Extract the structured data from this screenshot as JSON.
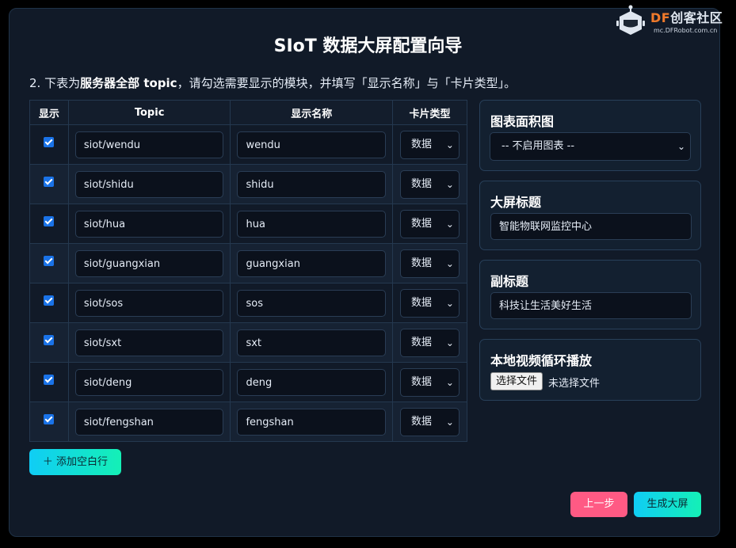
{
  "header": {
    "title": "SIoT 数据大屏配置向导",
    "logo_brand": "DF",
    "logo_name": "创客社区",
    "logo_url": "mc.DFRobot.com.cn"
  },
  "intro": {
    "prefix": "2. 下表为",
    "bold1": "服务器全部 topic",
    "middle": "，请勾选需要显示的模块，并填写「显示名称」与「卡片类型」。"
  },
  "table": {
    "headers": [
      "显示",
      "Topic",
      "显示名称",
      "卡片类型"
    ],
    "rows": [
      {
        "checked": true,
        "topic": "siot/wendu",
        "name": "wendu",
        "type": "数据"
      },
      {
        "checked": true,
        "topic": "siot/shidu",
        "name": "shidu",
        "type": "数据"
      },
      {
        "checked": true,
        "topic": "siot/hua",
        "name": "hua",
        "type": "数据"
      },
      {
        "checked": true,
        "topic": "siot/guangxian",
        "name": "guangxian",
        "type": "数据"
      },
      {
        "checked": true,
        "topic": "siot/sos",
        "name": "sos",
        "type": "数据"
      },
      {
        "checked": true,
        "topic": "siot/sxt",
        "name": "sxt",
        "type": "数据"
      },
      {
        "checked": true,
        "topic": "siot/deng",
        "name": "deng",
        "type": "数据"
      },
      {
        "checked": true,
        "topic": "siot/fengshan",
        "name": "fengshan",
        "type": "数据"
      }
    ]
  },
  "add_row_label": "＋ 添加空白行",
  "side": {
    "chart": {
      "title": "图表面积图",
      "value": "-- 不启用图表 --"
    },
    "screen_title": {
      "title": "大屏标题",
      "value": "智能物联网监控中心"
    },
    "subtitle": {
      "title": "副标题",
      "value": "科技让生活美好生活"
    },
    "video": {
      "title": "本地视频循环播放",
      "button": "选择文件",
      "status": "未选择文件"
    }
  },
  "footer": {
    "prev": "上一步",
    "generate": "生成大屏"
  },
  "colors": {
    "accent_cyan": "#10cdf5",
    "accent_pink": "#ff5a84",
    "checkbox_blue": "#1a73e8",
    "logo_orange": "#f07a2b"
  }
}
